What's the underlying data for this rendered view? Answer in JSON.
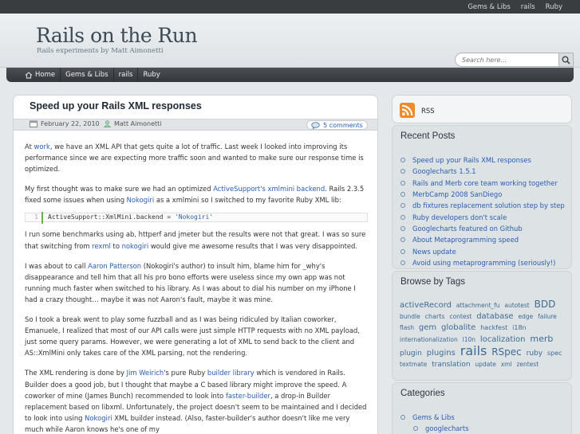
{
  "topnav": [
    "Gems & Libs",
    "rails",
    "Ruby"
  ],
  "site": {
    "title": "Rails on the Run",
    "tagline": "Rails experiments by Matt Aimonetti"
  },
  "search": {
    "placeholder": "Search here..."
  },
  "nav": [
    {
      "label": "Home",
      "icon": "home-icon"
    },
    {
      "label": "Gems & Libs"
    },
    {
      "label": "rails"
    },
    {
      "label": "Ruby"
    }
  ],
  "post": {
    "title": "Speed up your Rails XML responses",
    "date": "February 22, 2010",
    "author": "Matt Aimonetti",
    "comments": "5 comments",
    "p1": {
      "a": "At ",
      "work": "work",
      "b": ", we have an XML API that gets quite a lot of traffic. Last week I looked into improving its performance since we are expecting more traffic soon and wanted to make sure our response time is optimized."
    },
    "p2": {
      "a": "My first thought was to make sure we had  an optimized ",
      "link1": "ActiveSupport's xmlmini backend",
      "b": ". Rails 2.3.5 fixed some issues when using ",
      "link2": "Nokogiri",
      "c": " as a xmlmini so I switched to my favorite Ruby XML lib:"
    },
    "code": {
      "line": "1",
      "code_prefix": "ActiveSupport::XmlMini.backend = ",
      "code_string": "'Nokogiri'"
    },
    "p3": {
      "a": "I run some benchmarks using ab, httperf and jmeter but the results were not that great. I was so sure that switching from ",
      "link1": "rexml",
      "b": " to ",
      "link2": "nokogiri",
      "c": " would give me awesome results that I was very disappointed."
    },
    "p4": {
      "a": "I was about to call ",
      "link1": "Aaron Patterson",
      "b": " (Nokogiri's author) to insult him, blame him for _why's disappearance and tell him that all his pro bono efforts were useless since my own app was not running much faster when switched to his library. As I was about to dial his number on my iPhone I had a crazy thought… maybe it was not Aaron's fault, maybe it was mine."
    },
    "p5": "So I took a break went to play some fuzzball and as I was being ridiculed by Italian coworker, Emanuele, I realized that most of our API calls were just simple HTTP requests with no XML payload, just some query params. However, we were generating a lot of XML to send back to the client and AS::XmlMini only takes care of the XML parsing, not the rendering.",
    "p6": {
      "a": "The XML rendering is done by ",
      "link1": "Jim Weirich",
      "b": "'s pure Ruby ",
      "link2": "builder library",
      "c": " which is vendored in Rails. Builder does a good job, but I thought that maybe a C based library might improve the speed. A coworker of mine (James Bunch) recommended to look into ",
      "link3": "faster-builder",
      "d": ", a drop-in Builder replacement based on libxml. Unfortunately, the project doesn't seem to be maintained and I decided to look into using ",
      "link4": "Nokogiri",
      "e": " XML builder instead. (Also, faster-builder's author doesn't like me very much while Aaron knows he's one of my"
    }
  },
  "sidebar": {
    "rss": "RSS",
    "recent_title": "Recent Posts",
    "recent": [
      "Speed up your Rails XML responses",
      "Googlecharts 1.5.1",
      "Rails and Merb core team working together",
      "MerbCamp 2008 SanDiego",
      "db fixtures replacement solution step by step",
      "Ruby developers don't scale",
      "Googlecharts featured on Github",
      "About Metaprogramming speed",
      "News update",
      "Avoid using metaprogramming (seriously!)"
    ],
    "tags_title": "Browse by Tags",
    "tags": [
      {
        "t": "activeRecord",
        "s": 10
      },
      {
        "t": "attachment_fu",
        "s": 7.5
      },
      {
        "t": "autotest",
        "s": 7.5
      },
      {
        "t": "BDD",
        "s": 12
      },
      {
        "t": "bundle",
        "s": 7.5
      },
      {
        "t": "charts",
        "s": 8
      },
      {
        "t": "contest",
        "s": 7.5
      },
      {
        "t": "database",
        "s": 10
      },
      {
        "t": "edge",
        "s": 7.5
      },
      {
        "t": "failure",
        "s": 7.5
      },
      {
        "t": "flash",
        "s": 7.5
      },
      {
        "t": "gem",
        "s": 10
      },
      {
        "t": "globalite",
        "s": 10
      },
      {
        "t": "hackfest",
        "s": 8
      },
      {
        "t": "i18n",
        "s": 8
      },
      {
        "t": "internationalization",
        "s": 7.5
      },
      {
        "t": "l10n",
        "s": 7.5
      },
      {
        "t": "localization",
        "s": 10
      },
      {
        "t": "merb",
        "s": 11
      },
      {
        "t": "plugin",
        "s": 9
      },
      {
        "t": "plugins",
        "s": 10
      },
      {
        "t": "rails",
        "s": 16
      },
      {
        "t": "RSpec",
        "s": 12
      },
      {
        "t": "ruby",
        "s": 9
      },
      {
        "t": "spec",
        "s": 8
      },
      {
        "t": "textmate",
        "s": 7.5
      },
      {
        "t": "translation",
        "s": 9
      },
      {
        "t": "update",
        "s": 7.5
      },
      {
        "t": "xml",
        "s": 7.5
      },
      {
        "t": "zentest",
        "s": 7.5
      }
    ],
    "cats_title": "Categories",
    "cats": [
      "Gems & Libs",
      "googlecharts"
    ]
  }
}
